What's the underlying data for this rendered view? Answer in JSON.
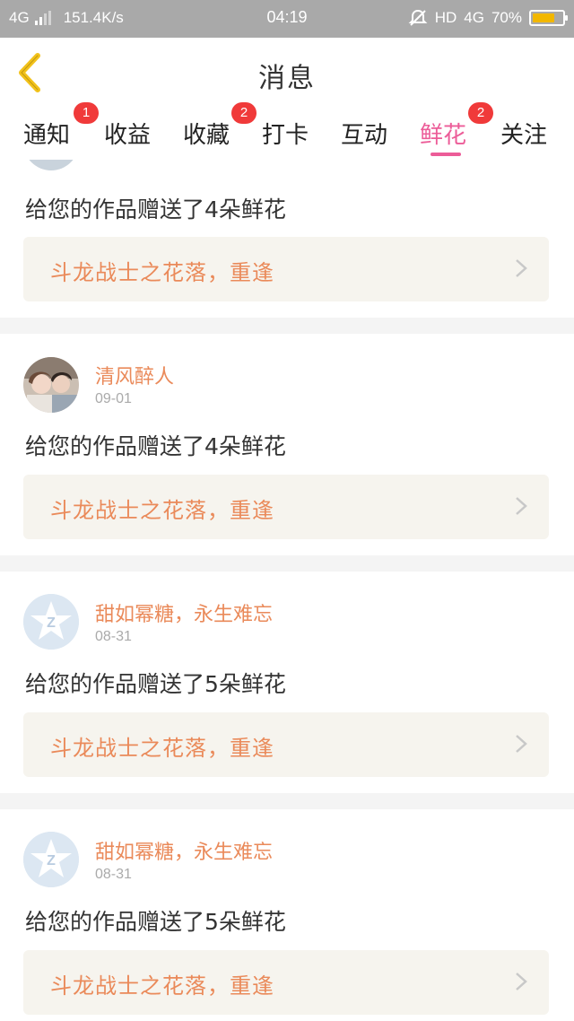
{
  "status_bar": {
    "network": "4G",
    "speed": "151.4K/s",
    "time": "04:19",
    "hd": "HD",
    "network_right": "4G",
    "battery": "70%"
  },
  "header": {
    "title": "消息"
  },
  "tabs": [
    {
      "label": "通知",
      "badge": "1"
    },
    {
      "label": "收益",
      "badge": ""
    },
    {
      "label": "收藏",
      "badge": "2"
    },
    {
      "label": "打卡",
      "badge": ""
    },
    {
      "label": "互动",
      "badge": ""
    },
    {
      "label": "鲜花",
      "badge": "2",
      "active": true
    },
    {
      "label": "关注",
      "badge": ""
    }
  ],
  "messages": [
    {
      "user": "",
      "date": "",
      "text": "给您的作品赠送了4朵鲜花",
      "work": "斗龙战士之花落，重逢",
      "avatar": "partial"
    },
    {
      "user": "清风醉人",
      "date": "09-01",
      "text": "给您的作品赠送了4朵鲜花",
      "work": "斗龙战士之花落，重逢",
      "avatar": "photo"
    },
    {
      "user": "甜如幂糖，永生难忘",
      "date": "08-31",
      "text": "给您的作品赠送了5朵鲜花",
      "work": "斗龙战士之花落，重逢",
      "avatar": "default"
    },
    {
      "user": "甜如幂糖，永生难忘",
      "date": "08-31",
      "text": "给您的作品赠送了5朵鲜花",
      "work": "斗龙战士之花落，重逢",
      "avatar": "default"
    }
  ],
  "colors": {
    "accent": "#ec5c98",
    "username": "#ea8a5a",
    "badge": "#f03a3a",
    "back_arrow": "#f2c21b"
  }
}
